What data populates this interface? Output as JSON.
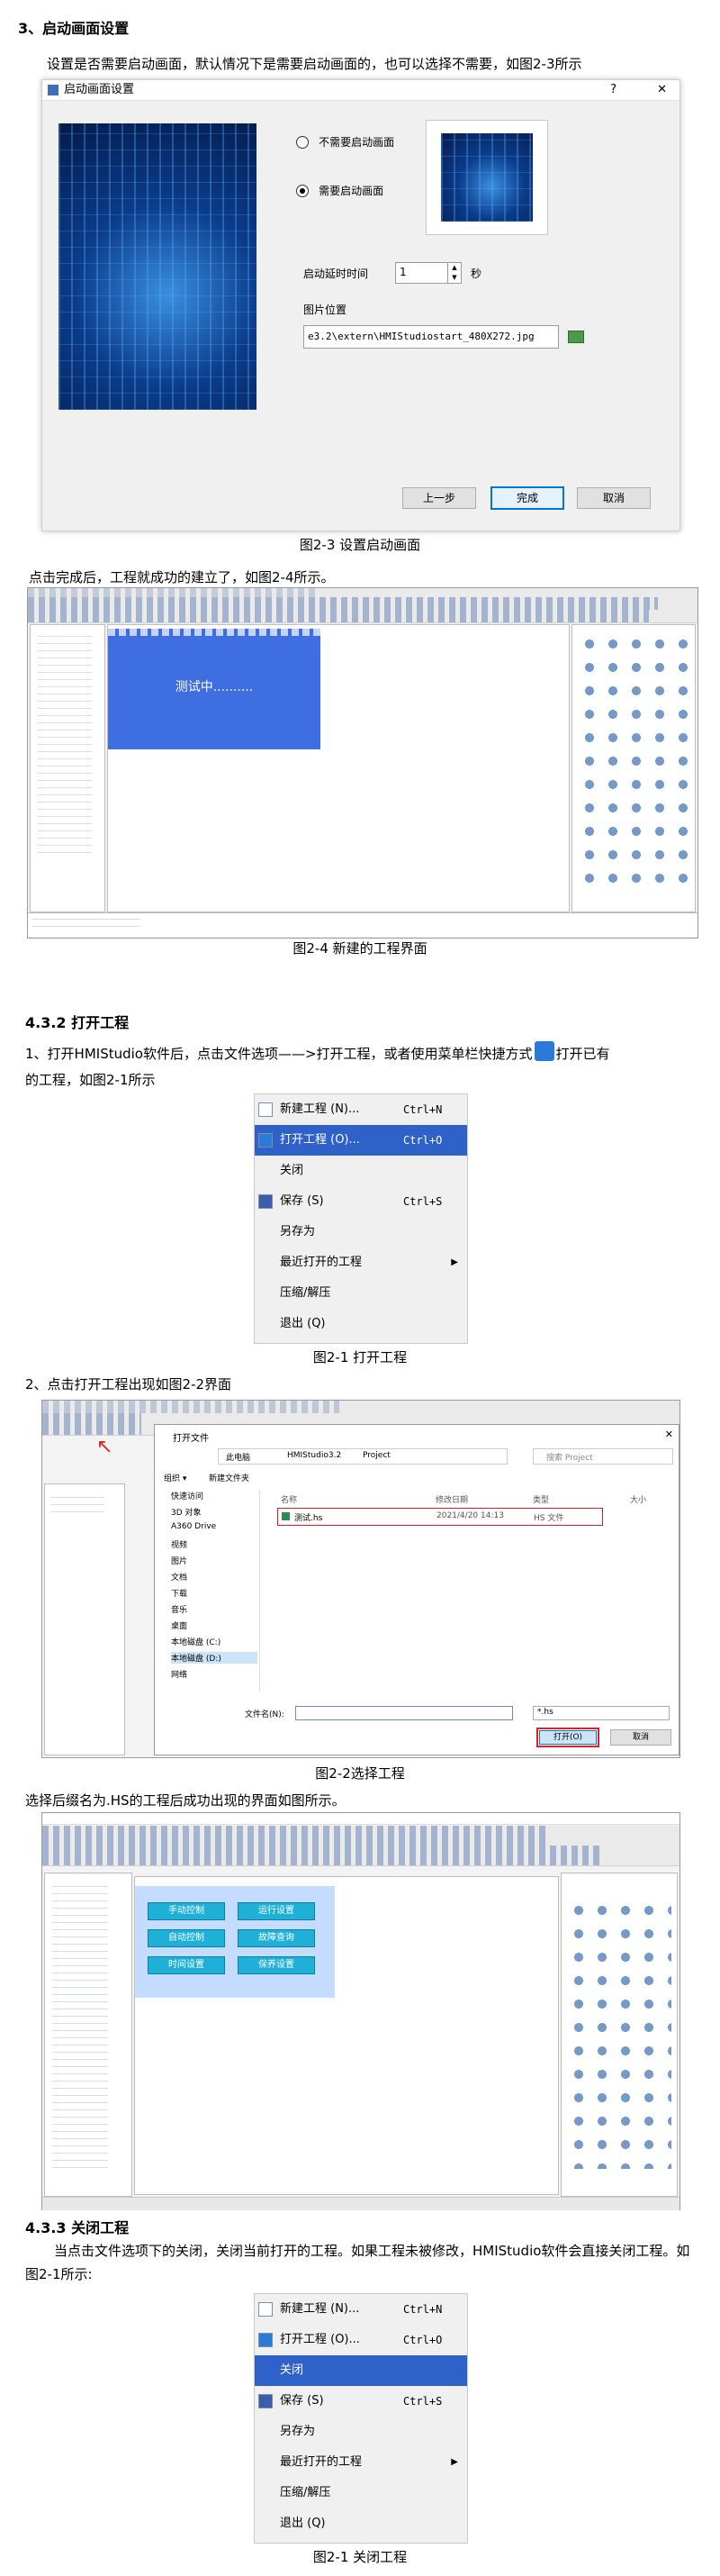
{
  "section_startup": {
    "heading": "3、启动画面设置",
    "paragraph": "设置是否需要启动画面，默认情况下是需要启动画面的，也可以选择不需要，如图2-3所示",
    "dialog": {
      "title": "启动画面设置",
      "help": "?",
      "close": "✕",
      "radio_no": "不需要启动画面",
      "radio_yes": "需要启动画面",
      "delay_label": "启动延时时间",
      "delay_value": "1",
      "delay_unit": "秒",
      "image_label": "图片位置",
      "image_path": "e3.2\\extern\\HMIStudiostart_480X272.jpg",
      "btn_prev": "上一步",
      "btn_finish": "完成",
      "btn_cancel": "取消"
    },
    "caption": "图2-3 设置启动画面"
  },
  "section_created": {
    "paragraph": "点击完成后，工程就成功的建立了，如图2-4所示。",
    "screen_text": "测试中..........",
    "caption": "图2-4 新建的工程界面"
  },
  "section_open": {
    "heading": "4.3.2 打开工程",
    "paragraph_a": "1、打开HMIStudio软件后，点击文件选项——>打开工程，或者使用菜单栏快捷方式",
    "paragraph_b": "打开已有",
    "paragraph_c": "的工程，如图2-1所示",
    "menu": [
      {
        "label": "新建工程 (N)...",
        "shortcut": "Ctrl+N",
        "icon": "new-file-icon"
      },
      {
        "label": "打开工程 (O)...",
        "shortcut": "Ctrl+O",
        "icon": "open-folder-icon"
      },
      {
        "label": "关闭",
        "shortcut": "",
        "icon": ""
      },
      {
        "label": "保存 (S)",
        "shortcut": "Ctrl+S",
        "icon": "save-icon"
      },
      {
        "label": "另存为",
        "shortcut": "",
        "icon": ""
      },
      {
        "label": "最近打开的工程",
        "shortcut": "",
        "icon": "",
        "submenu": "▶"
      },
      {
        "label": "压缩/解压",
        "shortcut": "",
        "icon": ""
      },
      {
        "label": "退出 (Q)",
        "shortcut": "",
        "icon": ""
      }
    ],
    "menu_selected_index": 1,
    "caption": "图2-1 打开工程",
    "step2": "2、点击打开工程出现如图2-2界面",
    "file_dialog": {
      "title": "打开文件",
      "path": [
        "此电脑",
        "HMIStudio3.2",
        "Project"
      ],
      "search_placeholder": "搜索 Project",
      "organize": "组织 ▾",
      "new_folder": "新建文件夹",
      "col_name": "名称",
      "col_date": "修改日期",
      "col_type": "类型",
      "col_size": "大小",
      "file_name": "测试.hs",
      "file_date": "2021/4/20 14:13",
      "file_type": "HS 文件",
      "nav": [
        "快速访问",
        "3D 对象",
        "A360 Drive",
        "视频",
        "图片",
        "文档",
        "下载",
        "音乐",
        "桌面",
        "本地磁盘 (C:)",
        "本地磁盘 (D:)",
        "网络"
      ],
      "filename_label": "文件名(N):",
      "filter": "*.hs",
      "btn_open": "打开(O)",
      "btn_cancel": "取消"
    },
    "caption2": "图2-2选择工程",
    "after": "选择后缀名为.HS的工程后成功出现的界面如图所示。",
    "ide_buttons": [
      "手动控制",
      "运行设置",
      "自动控制",
      "故障查询",
      "时间设置",
      "保养设置"
    ]
  },
  "section_close": {
    "heading": "4.3.3 关闭工程",
    "paragraph": "当点击文件选项下的关闭，关闭当前打开的工程。如果工程未被修改，HMIStudio软件会直接关闭工程。如图2-1所示:",
    "menu_selected_index": 2,
    "caption": "图2-1 关闭工程"
  }
}
